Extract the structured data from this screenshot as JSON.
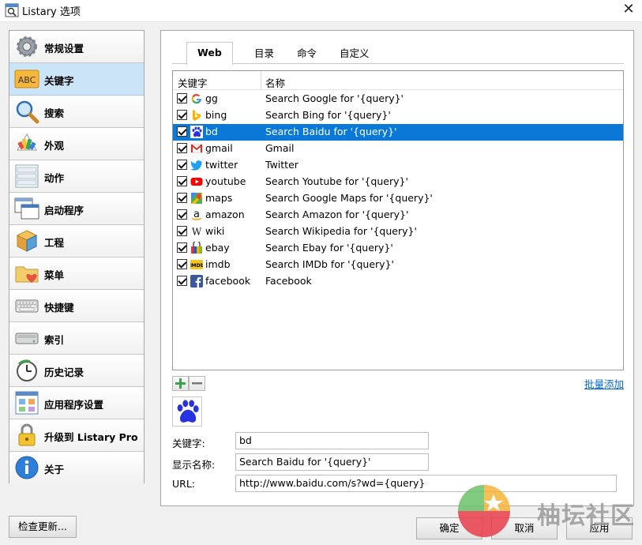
{
  "window": {
    "title": "Listary 选项",
    "close_glyph": "✕"
  },
  "sidebar": {
    "items": [
      {
        "label": "常规设置",
        "icon": "gear-icon"
      },
      {
        "label": "关键字",
        "icon": "abc-icon",
        "active": true
      },
      {
        "label": "搜索",
        "icon": "magnifier-icon"
      },
      {
        "label": "外观",
        "icon": "palette-icon"
      },
      {
        "label": "动作",
        "icon": "actions-icon"
      },
      {
        "label": "启动程序",
        "icon": "windows-icon"
      },
      {
        "label": "工程",
        "icon": "boxes-icon"
      },
      {
        "label": "菜单",
        "icon": "folder-heart-icon"
      },
      {
        "label": "快捷键",
        "icon": "keyboard-icon"
      },
      {
        "label": "索引",
        "icon": "drive-icon"
      },
      {
        "label": "历史记录",
        "icon": "clock-icon"
      },
      {
        "label": "应用程序设置",
        "icon": "app-grid-icon"
      },
      {
        "label": "升级到 Listary Pro",
        "icon": "lock-icon"
      },
      {
        "label": "关于",
        "icon": "info-icon"
      }
    ]
  },
  "tabs": [
    {
      "label": "Web",
      "active": true
    },
    {
      "label": "目录"
    },
    {
      "label": "命令"
    },
    {
      "label": "自定义"
    }
  ],
  "list": {
    "columns": {
      "keyword": "关键字",
      "name": "名称"
    },
    "rows": [
      {
        "keyword": "gg",
        "name": "Search Google for '{query}'",
        "icon": "google-icon"
      },
      {
        "keyword": "bing",
        "name": "Search Bing for '{query}'",
        "icon": "bing-icon"
      },
      {
        "keyword": "bd",
        "name": "Search Baidu for '{query}'",
        "icon": "baidu-icon",
        "selected": true
      },
      {
        "keyword": "gmail",
        "name": "Gmail",
        "icon": "gmail-icon"
      },
      {
        "keyword": "twitter",
        "name": "Twitter",
        "icon": "twitter-icon"
      },
      {
        "keyword": "youtube",
        "name": "Search Youtube for '{query}'",
        "icon": "youtube-icon"
      },
      {
        "keyword": "maps",
        "name": "Search Google Maps for '{query}'",
        "icon": "maps-icon"
      },
      {
        "keyword": "amazon",
        "name": "Search Amazon for '{query}'",
        "icon": "amazon-icon"
      },
      {
        "keyword": "wiki",
        "name": "Search Wikipedia for '{query}'",
        "icon": "wikipedia-icon"
      },
      {
        "keyword": "ebay",
        "name": "Search Ebay for '{query}'",
        "icon": "ebay-icon"
      },
      {
        "keyword": "imdb",
        "name": "Search IMDb for '{query}'",
        "icon": "imdb-icon"
      },
      {
        "keyword": "facebook",
        "name": "Facebook",
        "icon": "facebook-icon"
      }
    ]
  },
  "list_actions": {
    "batch_add": "批量添加"
  },
  "details": {
    "keyword_label": "关键字:",
    "keyword_value": "bd",
    "display_label": "显示名称:",
    "display_value": "Search Baidu for '{query}'",
    "url_label": "URL:",
    "url_value": "http://www.baidu.com/s?wd={query}"
  },
  "footer": {
    "check_updates": "检查更新...",
    "ok": "确定",
    "cancel": "取消",
    "apply": "应用"
  },
  "watermark": {
    "text": "柚坛社区"
  },
  "colors": {
    "selected_row": "#0a78d7",
    "link": "#0066cc",
    "active_sidebar": "#cce4f7"
  }
}
